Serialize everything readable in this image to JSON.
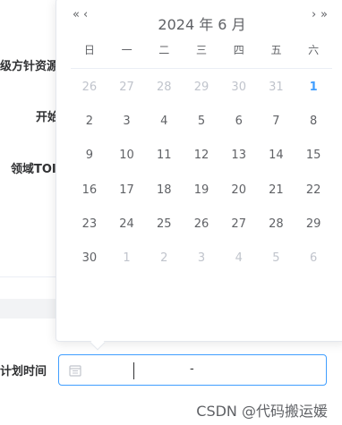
{
  "form": {
    "label_1": "级方针资源",
    "label_2": "开始",
    "label_3": "领域TOI",
    "label_4": "计划时间",
    "range_separator": "-"
  },
  "picker": {
    "title": "2024 年 6 月",
    "nav_prev_year": "«",
    "nav_prev_month": "‹",
    "nav_next_month": "›",
    "nav_next_year": "»",
    "weekdays": [
      "日",
      "一",
      "二",
      "三",
      "四",
      "五",
      "六"
    ],
    "days": [
      {
        "label": "26",
        "state": "prev"
      },
      {
        "label": "27",
        "state": "prev"
      },
      {
        "label": "28",
        "state": "prev"
      },
      {
        "label": "29",
        "state": "prev"
      },
      {
        "label": "30",
        "state": "prev"
      },
      {
        "label": "31",
        "state": "prev"
      },
      {
        "label": "1",
        "state": "today"
      },
      {
        "label": "2",
        "state": "cur"
      },
      {
        "label": "3",
        "state": "cur"
      },
      {
        "label": "4",
        "state": "cur"
      },
      {
        "label": "5",
        "state": "cur"
      },
      {
        "label": "6",
        "state": "cur"
      },
      {
        "label": "7",
        "state": "cur"
      },
      {
        "label": "8",
        "state": "cur"
      },
      {
        "label": "9",
        "state": "cur"
      },
      {
        "label": "10",
        "state": "cur"
      },
      {
        "label": "11",
        "state": "cur"
      },
      {
        "label": "12",
        "state": "cur"
      },
      {
        "label": "13",
        "state": "cur"
      },
      {
        "label": "14",
        "state": "cur"
      },
      {
        "label": "15",
        "state": "cur"
      },
      {
        "label": "16",
        "state": "cur"
      },
      {
        "label": "17",
        "state": "cur"
      },
      {
        "label": "18",
        "state": "cur"
      },
      {
        "label": "19",
        "state": "cur"
      },
      {
        "label": "20",
        "state": "cur"
      },
      {
        "label": "21",
        "state": "cur"
      },
      {
        "label": "22",
        "state": "cur"
      },
      {
        "label": "23",
        "state": "cur"
      },
      {
        "label": "24",
        "state": "cur"
      },
      {
        "label": "25",
        "state": "cur"
      },
      {
        "label": "26",
        "state": "cur"
      },
      {
        "label": "27",
        "state": "cur"
      },
      {
        "label": "28",
        "state": "cur"
      },
      {
        "label": "29",
        "state": "cur"
      },
      {
        "label": "30",
        "state": "cur"
      },
      {
        "label": "1",
        "state": "next"
      },
      {
        "label": "2",
        "state": "next"
      },
      {
        "label": "3",
        "state": "next"
      },
      {
        "label": "4",
        "state": "next"
      },
      {
        "label": "5",
        "state": "next"
      },
      {
        "label": "6",
        "state": "next"
      }
    ]
  },
  "watermark": "CSDN @代码搬运媛",
  "colors": {
    "accent": "#409eff",
    "muted": "#c0c4cc",
    "text": "#606266"
  }
}
